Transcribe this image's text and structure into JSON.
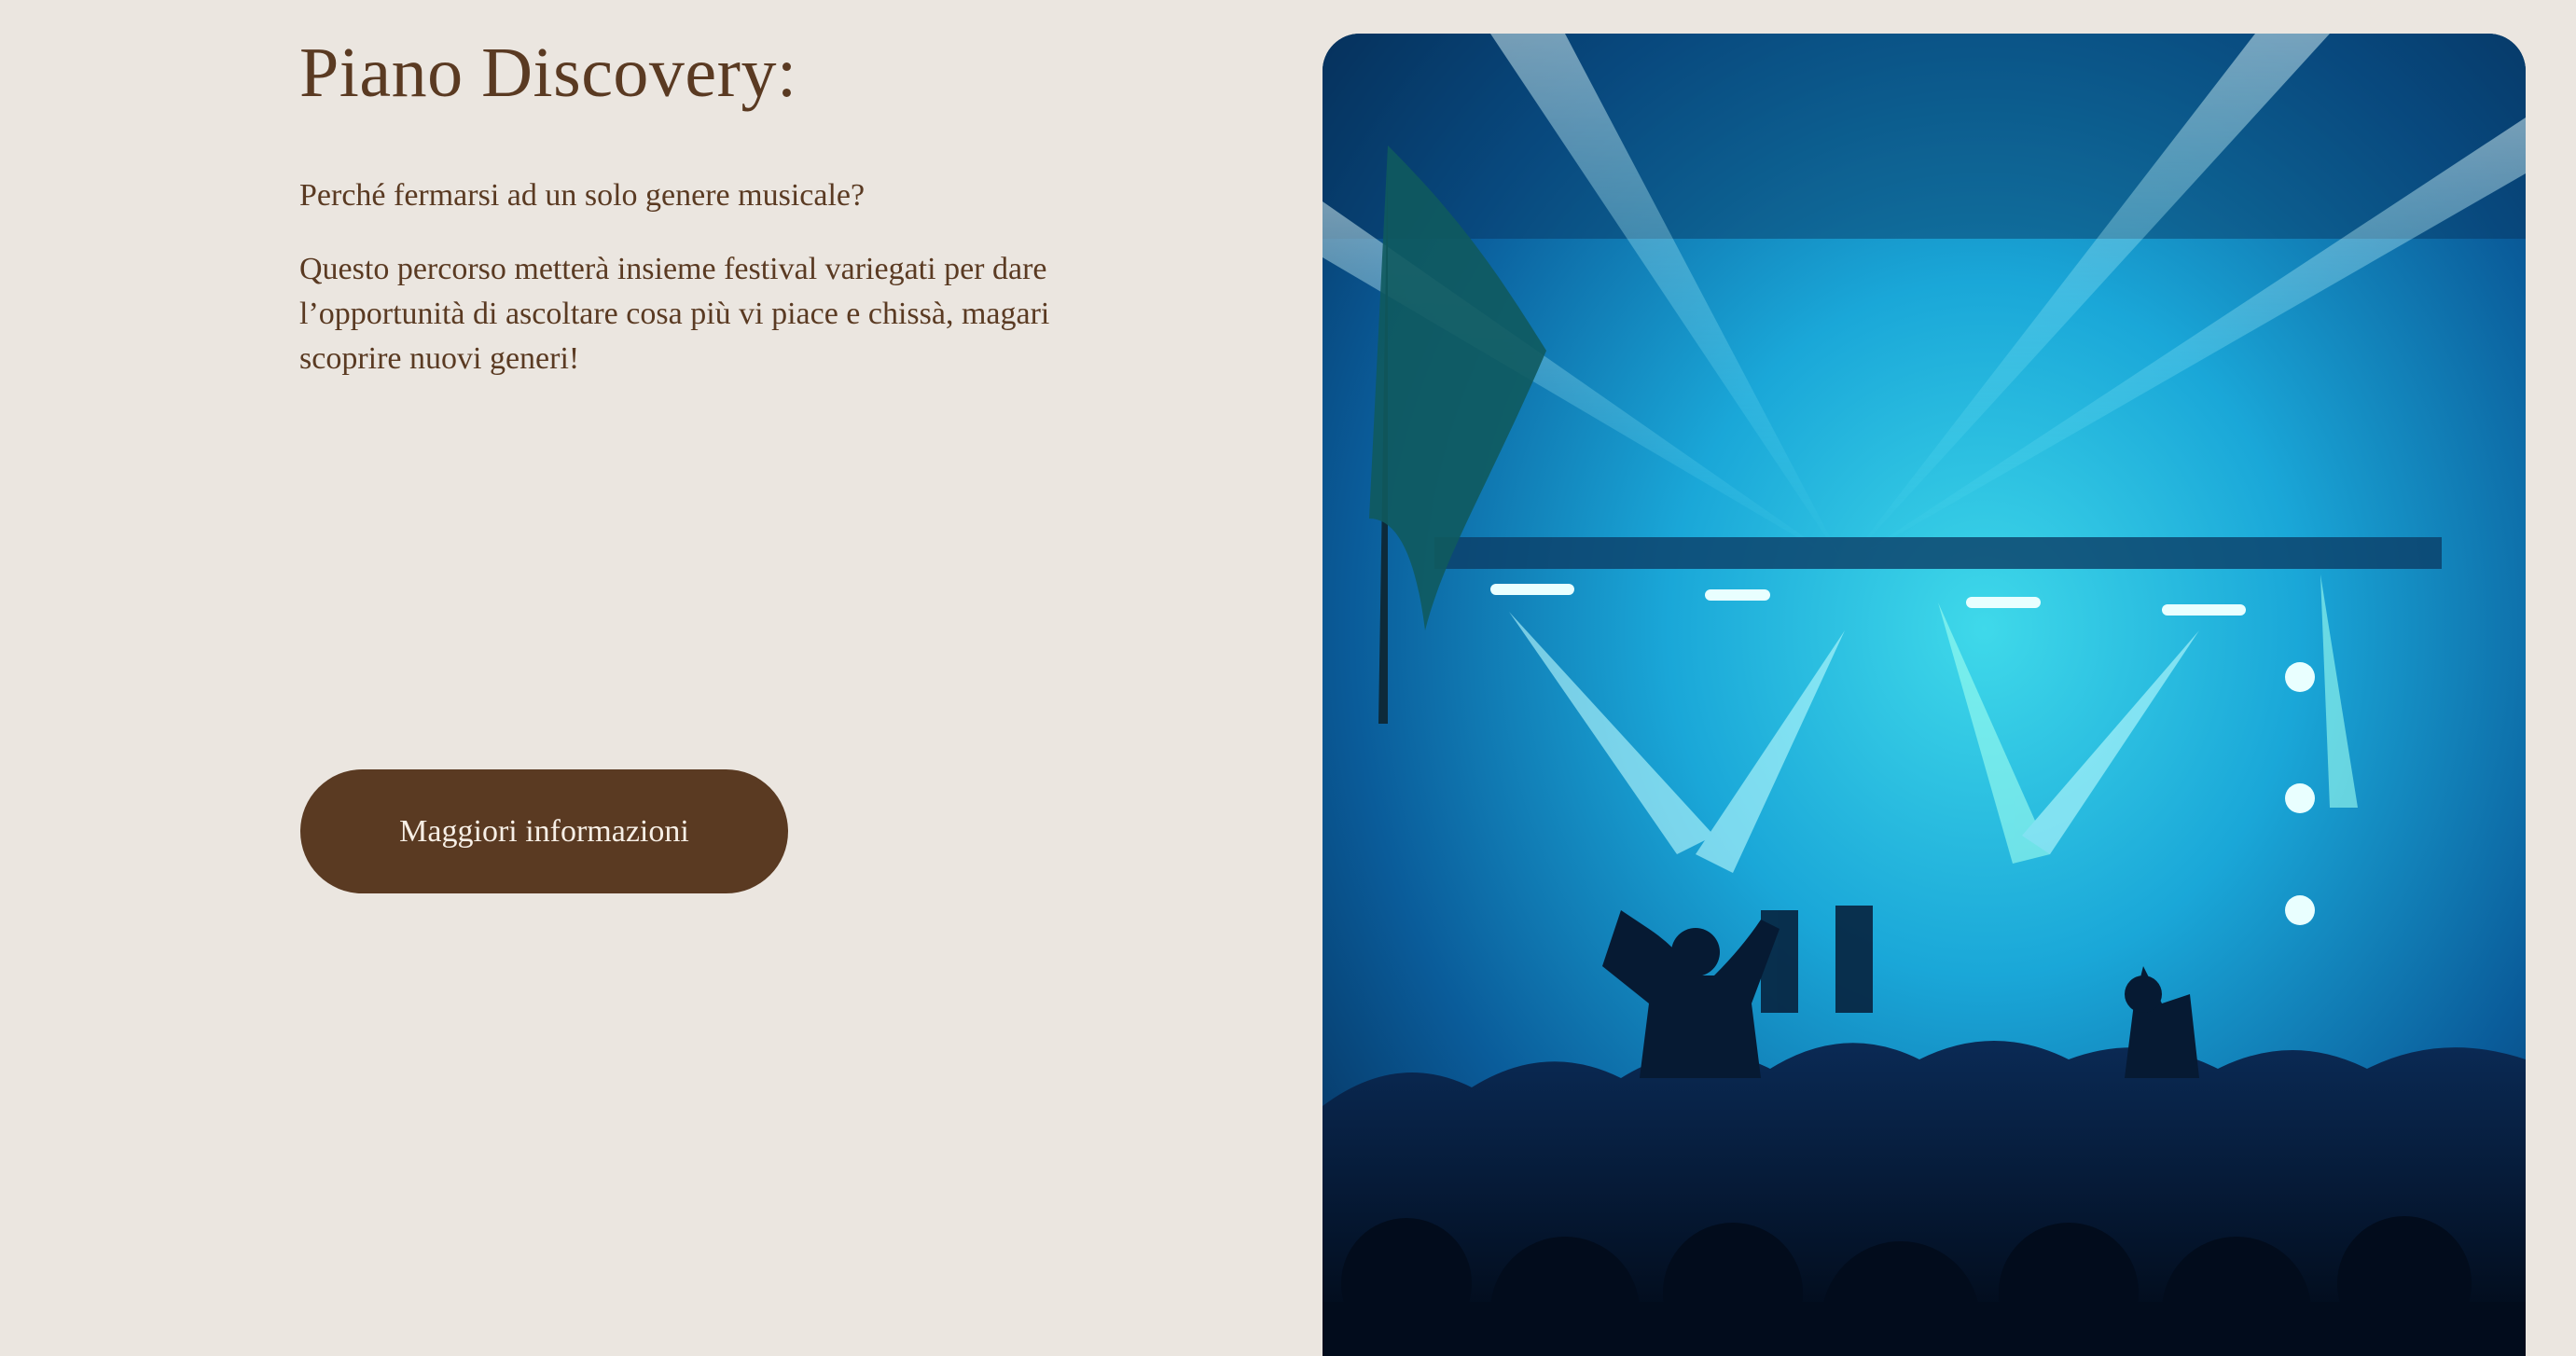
{
  "section": {
    "title": "Piano Discovery:",
    "intro": "Perché fermarsi ad un solo genere musicale?",
    "body": "Questo percorso metterà insieme festival variegati per dare l’opportunità di ascoltare cosa più vi piace e chissà, magari scoprire nuovi generi!",
    "cta_label": "Maggiori informazioni"
  },
  "colors": {
    "background": "#ebe6e0",
    "text": "#5a3a22",
    "button": "#5a3a22",
    "button_text": "#f7efe6"
  }
}
